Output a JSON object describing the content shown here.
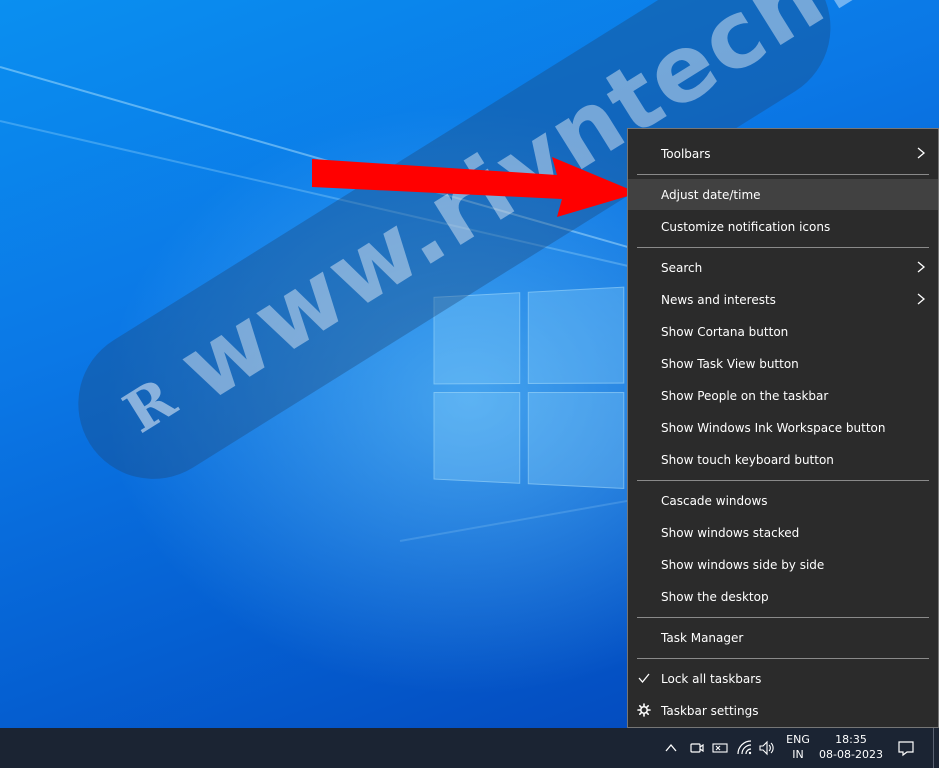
{
  "watermark": {
    "text": "www.rivntech.com",
    "logo_letter": "R"
  },
  "context_menu": {
    "items": [
      {
        "label": "Toolbars",
        "has_submenu": true
      },
      {
        "label": "Adjust date/time",
        "highlighted": true
      },
      {
        "label": "Customize notification icons"
      },
      {
        "label": "Search",
        "has_submenu": true
      },
      {
        "label": "News and interests",
        "has_submenu": true
      },
      {
        "label": "Show Cortana button"
      },
      {
        "label": "Show Task View button"
      },
      {
        "label": "Show People on the taskbar"
      },
      {
        "label": "Show Windows Ink Workspace button"
      },
      {
        "label": "Show touch keyboard button"
      },
      {
        "label": "Cascade windows"
      },
      {
        "label": "Show windows stacked"
      },
      {
        "label": "Show windows side by side"
      },
      {
        "label": "Show the desktop"
      },
      {
        "label": "Task Manager"
      },
      {
        "label": "Lock all taskbars",
        "checked": true
      },
      {
        "label": "Taskbar settings",
        "icon": "gear-icon"
      }
    ]
  },
  "taskbar": {
    "language": {
      "line1": "ENG",
      "line2": "IN"
    },
    "clock": {
      "time": "18:35",
      "date": "08-08-2023"
    },
    "tray_icons": [
      "chevron-up-icon",
      "meet-now-icon",
      "pen-icon",
      "wifi-icon",
      "volume-icon",
      "notification-icon"
    ]
  },
  "colors": {
    "menu_bg": "#2b2b2b",
    "menu_highlight": "#414141",
    "taskbar_bg": "#1b2433",
    "arrow_red": "#ff0000"
  }
}
